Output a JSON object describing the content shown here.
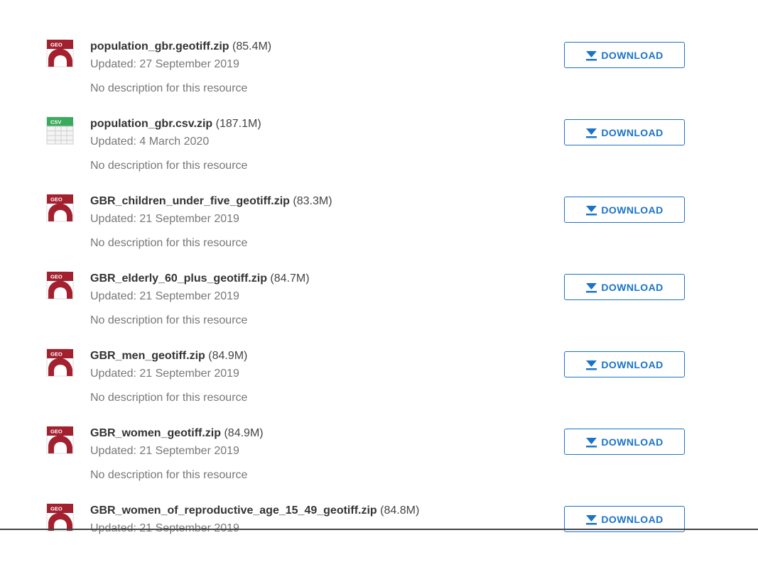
{
  "download_label": "DOWNLOAD",
  "colors": {
    "accent": "#1a73c8",
    "geo_icon": "#a3202f",
    "csv_icon": "#3aaa5c"
  },
  "resources": [
    {
      "name": "population_gbr.geotiff.zip",
      "size": "(85.4M)",
      "updated": "Updated: 27 September 2019",
      "description": "No description for this resource",
      "icon_type": "geo",
      "icon_label": "GEO"
    },
    {
      "name": "population_gbr.csv.zip",
      "size": "(187.1M)",
      "updated": "Updated: 4 March 2020",
      "description": "No description for this resource",
      "icon_type": "csv",
      "icon_label": "CSV"
    },
    {
      "name": "GBR_children_under_five_geotiff.zip",
      "size": "(83.3M)",
      "updated": "Updated: 21 September 2019",
      "description": "No description for this resource",
      "icon_type": "geo",
      "icon_label": "GEO"
    },
    {
      "name": "GBR_elderly_60_plus_geotiff.zip",
      "size": "(84.7M)",
      "updated": "Updated: 21 September 2019",
      "description": "No description for this resource",
      "icon_type": "geo",
      "icon_label": "GEO"
    },
    {
      "name": "GBR_men_geotiff.zip",
      "size": "(84.9M)",
      "updated": "Updated: 21 September 2019",
      "description": "No description for this resource",
      "icon_type": "geo",
      "icon_label": "GEO"
    },
    {
      "name": "GBR_women_geotiff.zip",
      "size": "(84.9M)",
      "updated": "Updated: 21 September 2019",
      "description": "No description for this resource",
      "icon_type": "geo",
      "icon_label": "GEO"
    },
    {
      "name": "GBR_women_of_reproductive_age_15_49_geotiff.zip",
      "size": "(84.8M)",
      "updated": "Updated: 21 September 2019",
      "description": "",
      "icon_type": "geo",
      "icon_label": "GEO"
    }
  ]
}
